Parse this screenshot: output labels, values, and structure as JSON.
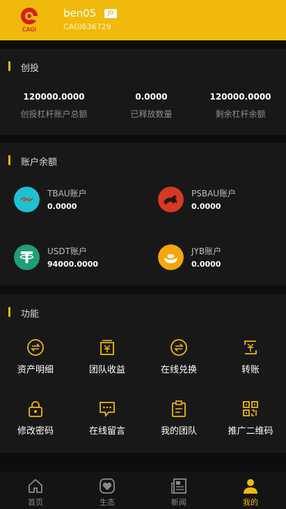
{
  "colors": {
    "accent": "#f0b90b",
    "background": "#0d0d0d",
    "card": "#181818"
  },
  "header": {
    "logo_text": "CAGI",
    "username": "ben05",
    "level": "J0",
    "user_id": "CAGI636729"
  },
  "investment": {
    "title": "创投",
    "stats": [
      {
        "value": "120000.0000",
        "label": "创投杠杆账户总额"
      },
      {
        "value": "0.0000",
        "label": "已释放数量"
      },
      {
        "value": "120000.0000",
        "label": "剩余杠杆余额"
      }
    ]
  },
  "balances": {
    "title": "账户余额",
    "accounts": [
      {
        "name": "TBAU账户",
        "value": "0.0000",
        "icon": "tbau-icon",
        "color": "#1ec0d6"
      },
      {
        "name": "PSBAU账户",
        "value": "0.0000",
        "icon": "horse-icon",
        "color": "#d63a22"
      },
      {
        "name": "USDT账户",
        "value": "94000.0000",
        "icon": "tether-icon",
        "color": "#1f9e77"
      },
      {
        "name": "JYB账户",
        "value": "0.0000",
        "icon": "gold-ingot-icon",
        "color": "#f5a60b"
      }
    ]
  },
  "functions": {
    "title": "功能",
    "items": [
      {
        "label": "资产明细",
        "icon": "exchange-circle-icon"
      },
      {
        "label": "团队收益",
        "icon": "yuan-box-icon"
      },
      {
        "label": "在线兑换",
        "icon": "exchange-circle-icon"
      },
      {
        "label": "转账",
        "icon": "transfer-yuan-icon"
      },
      {
        "label": "修改密码",
        "icon": "lock-icon"
      },
      {
        "label": "在线留言",
        "icon": "message-icon"
      },
      {
        "label": "我的团队",
        "icon": "clipboard-icon"
      },
      {
        "label": "推广二维码",
        "icon": "qrcode-icon"
      }
    ]
  },
  "nav": {
    "items": [
      {
        "label": "首页",
        "icon": "home-icon",
        "active": false
      },
      {
        "label": "生态",
        "icon": "ecology-icon",
        "active": false
      },
      {
        "label": "新闻",
        "icon": "news-icon",
        "active": false
      },
      {
        "label": "我的",
        "icon": "user-icon",
        "active": true
      }
    ]
  }
}
